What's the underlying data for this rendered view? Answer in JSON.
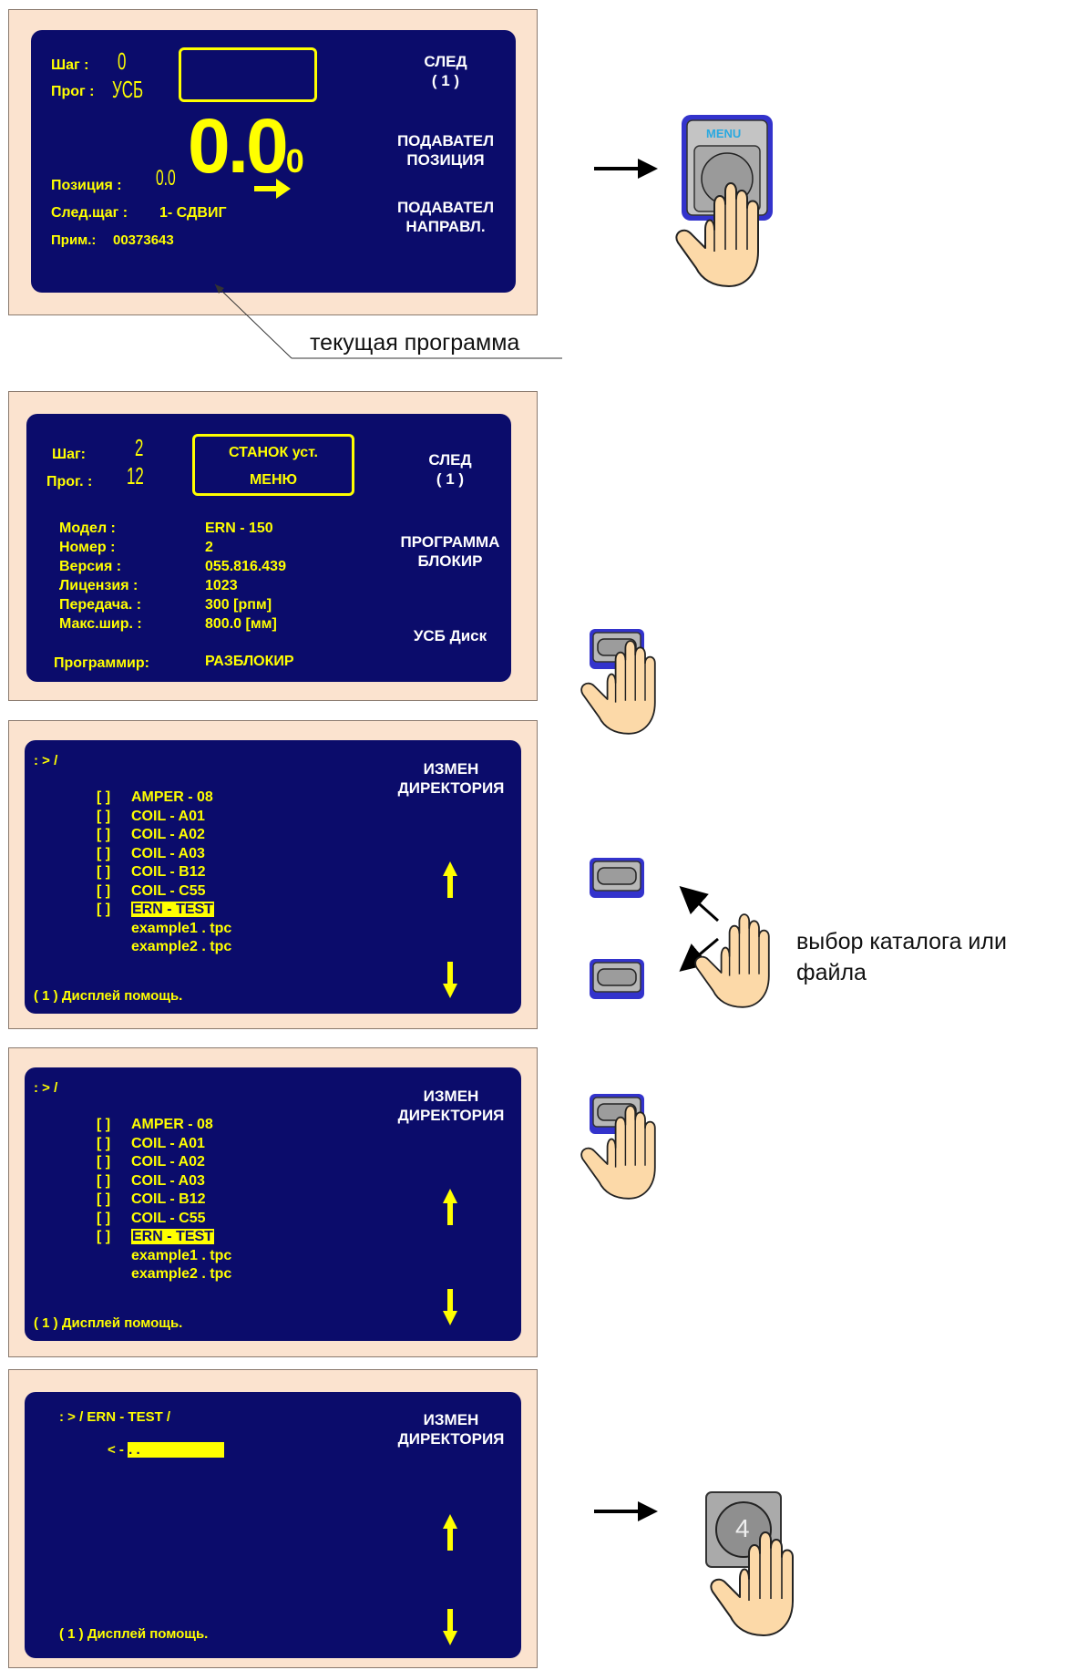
{
  "screen1": {
    "step_label": "Шаг :",
    "step_value": "0",
    "prog_label": "Прог :",
    "prog_value": "УСБ",
    "big_value": "0.0",
    "big_subscript": "0",
    "position_label": "Позиция :",
    "position_value": "0.0",
    "next_step_label": "След.щаг :",
    "next_step_value": "1- СДВИГ",
    "note_label": "Прим.:",
    "note_value": "00373643",
    "softkeys": [
      "СЛЕД",
      "( 1 )",
      "ПОДАВАТЕЛ",
      "ПОЗИЦИЯ",
      "ПОДАВАТЕЛ",
      "НАПРАВЛ."
    ]
  },
  "screen1_annotation": "текущая программа",
  "menu_key_label": "MENU",
  "screen2": {
    "step_label": "Шаг:",
    "step_value": "2",
    "prog_label": "Прог. :",
    "prog_value": "12",
    "title_line1": "СТАНОК уст.",
    "title_line2": "МЕНЮ",
    "info": [
      {
        "label": "Модел :",
        "value": "ERN - 150"
      },
      {
        "label": "Номер :",
        "value": "2"
      },
      {
        "label": "Версия :",
        "value": "055.816.439"
      },
      {
        "label": "Лицензия :",
        "value": "1023"
      },
      {
        "label": "Передача. :",
        "value": "300 [рпм]"
      },
      {
        "label": "Макс.шир. :",
        "value": "800.0 [мм]"
      }
    ],
    "prog_lock_label": "Программир:",
    "prog_lock_value": "РАЗБЛОКИР",
    "softkeys": [
      "СЛЕД",
      "( 1 )",
      "ПРОГРАММА",
      "БЛОКИР",
      "УСБ Диск"
    ]
  },
  "file_screen": {
    "path": ": > /",
    "softkey_line1": "ИЗМЕН",
    "softkey_line2": "ДИРЕКТОРИЯ",
    "items": [
      {
        "bracket": "[ ]",
        "name": "AMPER - 08"
      },
      {
        "bracket": "[ ]",
        "name": "COIL - A01"
      },
      {
        "bracket": "[ ]",
        "name": "COIL - A02"
      },
      {
        "bracket": "[ ]",
        "name": "COIL - A03"
      },
      {
        "bracket": "[ ]",
        "name": "COIL - B12"
      },
      {
        "bracket": "[ ]",
        "name": "COIL - C55"
      },
      {
        "bracket": "[ ]",
        "name": "ERN - TEST"
      },
      {
        "bracket": "",
        "name": "example1 . tpc"
      },
      {
        "bracket": "",
        "name": "example2 . tpc"
      }
    ],
    "selected_index": 6,
    "help": "( 1 ) Дисплей помощь."
  },
  "screen5": {
    "path": ": > / ERN - TEST /",
    "back_prefix": "< -",
    "back_item": ". .",
    "softkey_line1": "ИЗМЕН",
    "softkey_line2": "ДИРЕКТОРИЯ",
    "help": "( 1 ) Дисплей помощь."
  },
  "select_caption_line1": "выбор каталога или",
  "select_caption_line2": "файла",
  "key4_label": "4",
  "colors": {
    "screen_bg": "#0b0c6b",
    "screen_text": "#ffff00",
    "softkey_text": "#ffffff",
    "panel_bg": "#fbe3cf",
    "key_border": "#3333cc",
    "hand_fill": "#fcd9a8"
  }
}
